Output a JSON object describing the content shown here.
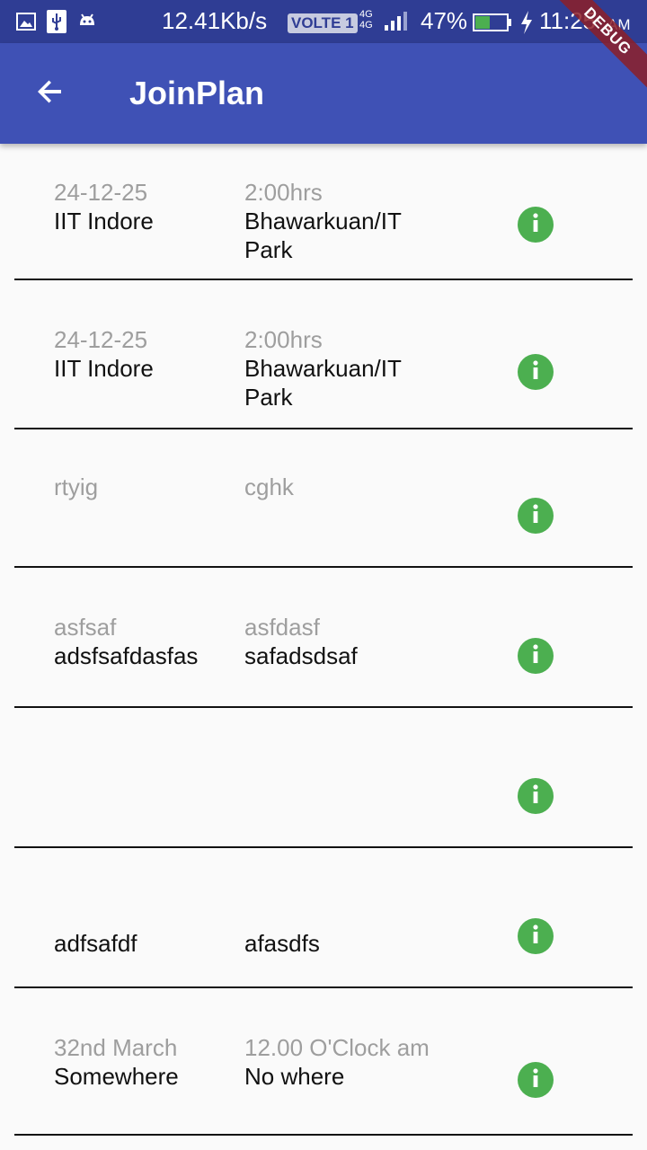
{
  "status_bar": {
    "speed": "12.41Kb/s",
    "volte": "VOLTE 1",
    "network": "4G 4G",
    "battery_percent": "47%",
    "battery_level": 0.47,
    "time": "11:25",
    "ampm": "AM",
    "icons": [
      "gallery-icon",
      "usb-icon",
      "android-icon",
      "signal-icon",
      "battery-icon",
      "charging-icon"
    ]
  },
  "app_bar": {
    "title": "JoinPlan",
    "back_icon": "arrow-back-icon",
    "color": "#3f51b5"
  },
  "debug_banner": "DEBUG",
  "plans": [
    {
      "date": "24-12-25",
      "duration": "2:00hrs",
      "from": "IIT Indore",
      "to": "Bhawarkuan/IT Park"
    },
    {
      "date": "24-12-25",
      "duration": "2:00hrs",
      "from": "IIT Indore",
      "to": "Bhawarkuan/IT Park"
    },
    {
      "date": "rtyig",
      "duration": "cghk",
      "from": "",
      "to": ""
    },
    {
      "date": "asfsaf",
      "duration": "asfdasf",
      "from": "adsfsafdasfas",
      "to": "safadsdsaf"
    },
    {
      "date": "",
      "duration": "",
      "from": "",
      "to": ""
    },
    {
      "date": "",
      "duration": "",
      "from": "adfsafdf",
      "to": "afasdfs"
    },
    {
      "date": "32nd March",
      "duration": "12.00 O'Clock am",
      "from": "Somewhere",
      "to": "No where"
    }
  ],
  "info_icon": "info-icon",
  "accent_color": "#4caf50"
}
